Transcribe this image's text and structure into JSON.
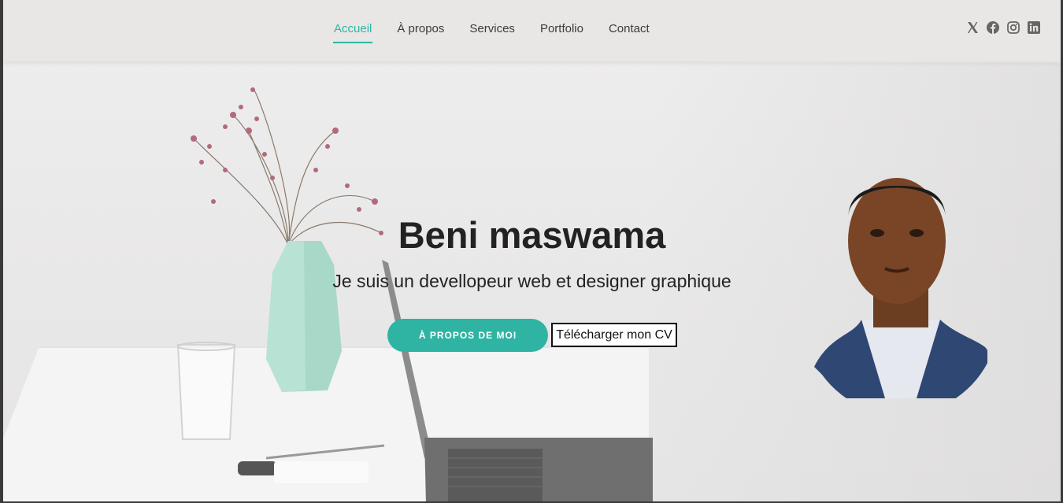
{
  "nav": {
    "items": [
      {
        "label": "Accueil",
        "active": true
      },
      {
        "label": "À propos"
      },
      {
        "label": "Services"
      },
      {
        "label": "Portfolio"
      },
      {
        "label": "Contact"
      }
    ],
    "social_icons": [
      "x-icon",
      "facebook-icon",
      "instagram-icon",
      "linkedin-icon"
    ]
  },
  "hero": {
    "name": "Beni maswama",
    "tagline": "Je suis un devellopeur web et designer graphique",
    "primary_button": "À PROPOS DE MOI",
    "secondary_button": "Télécharger mon CV"
  },
  "colors": {
    "accent": "#2fb4a3",
    "text": "#222222",
    "nav_bg": "#e8e7e6"
  }
}
